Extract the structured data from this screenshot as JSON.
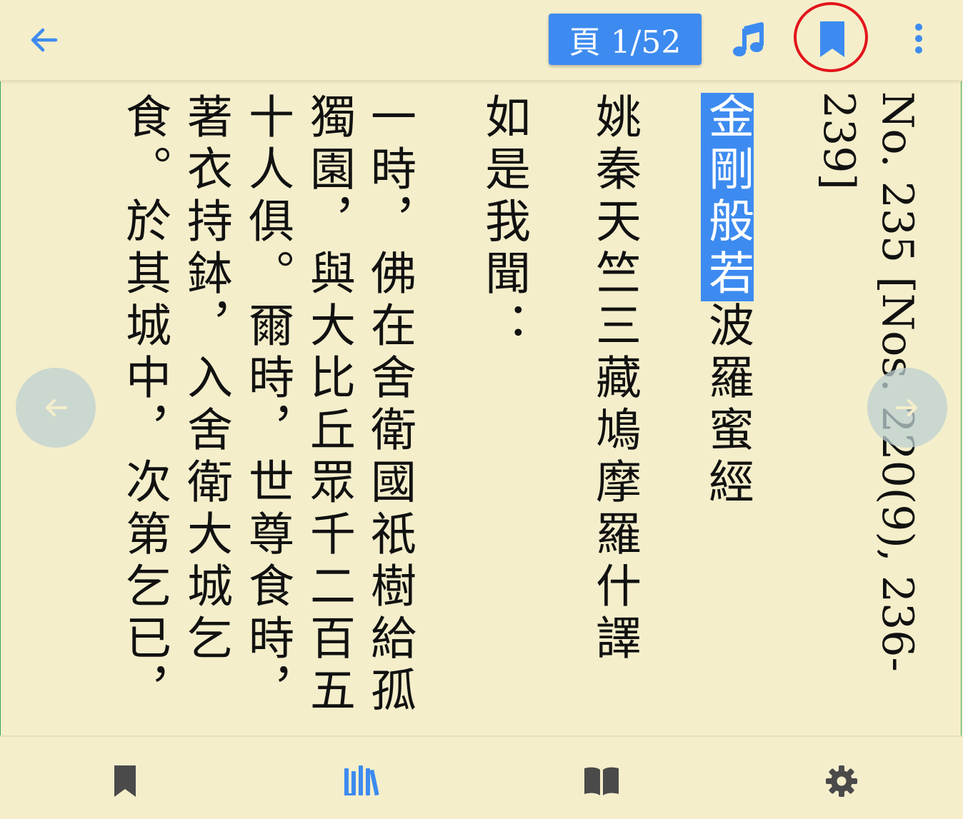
{
  "toolbar": {
    "back_icon": "arrow-left-icon",
    "page_label": "頁 1/52",
    "music_icon": "music-note-icon",
    "bookmark_icon": "bookmark-icon",
    "more_icon": "more-vert-icon"
  },
  "text": {
    "catalog_line1": "No. 235 [Nos. 220(9), 236-",
    "catalog_line2": "239]",
    "title_highlight": "金剛般若",
    "title_rest": "波羅蜜經",
    "translator": "姚秦天竺三藏鳩摩羅什譯",
    "rushi": "如是我聞：",
    "para": [
      "一時，佛在舍衛國祇樹給孤",
      "獨園，與大比丘眾千二百五",
      "十人俱。爾時，世尊食時，",
      "著衣持鉢，入舍衛大城乞",
      "食。於其城中，次第乞已，"
    ]
  },
  "nav": {
    "prev_icon": "arrow-left-icon",
    "next_icon": "arrow-right-icon"
  },
  "bottom_tabs": [
    {
      "icon": "bookmark-icon"
    },
    {
      "icon": "library-icon"
    },
    {
      "icon": "open-book-icon"
    },
    {
      "icon": "gear-icon"
    }
  ],
  "colors": {
    "background": "#f4eecb",
    "accent": "#3d8bf0",
    "tab_inactive": "#4a4a4a",
    "highlight_ring": "#e3141b"
  }
}
